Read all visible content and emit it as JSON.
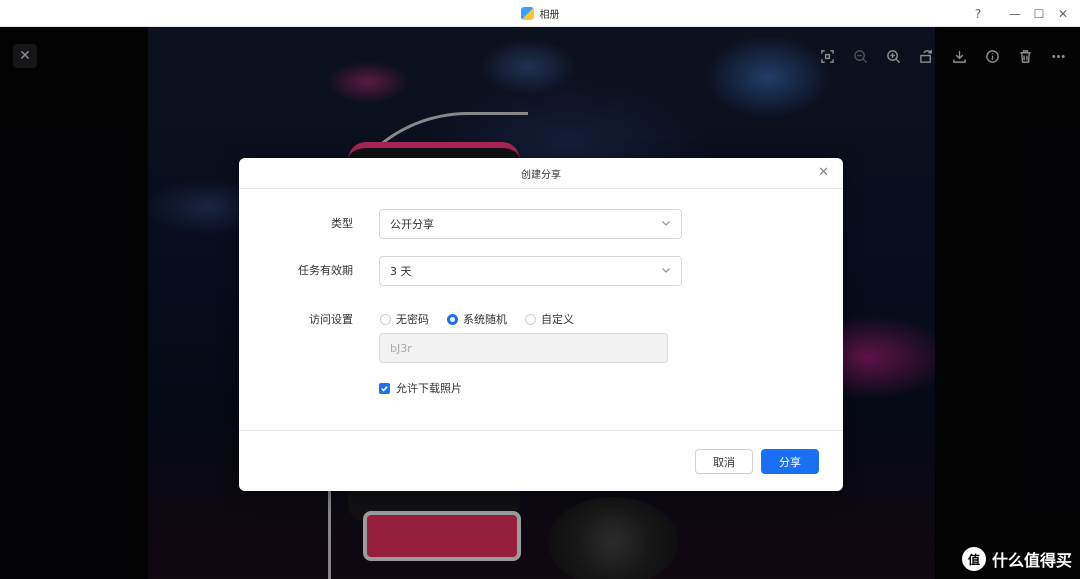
{
  "window": {
    "title": "相册",
    "controls": [
      "?",
      "—",
      "☐",
      "✕"
    ]
  },
  "viewer": {
    "toolbar_icons": [
      "scan-icon",
      "zoom-out-icon",
      "zoom-in-icon",
      "rotate-icon",
      "download-icon",
      "info-icon",
      "delete-icon",
      "more-icon"
    ]
  },
  "dialog": {
    "title": "创建分享",
    "type_label": "类型",
    "type_value": "公开分享",
    "expiry_label": "任务有效期",
    "expiry_value": "3 天",
    "access_label": "访问设置",
    "access_options": [
      {
        "label": "无密码",
        "selected": false
      },
      {
        "label": "系统随机",
        "selected": true
      },
      {
        "label": "自定义",
        "selected": false
      }
    ],
    "password_value": "bJ3r",
    "allow_download_label": "允许下载照片",
    "allow_download_checked": true,
    "cancel_label": "取消",
    "share_label": "分享"
  },
  "watermark": {
    "logo_text": "值",
    "text": "什么值得买"
  },
  "colors": {
    "accent": "#1a6ff5",
    "overlay": "rgba(0,0,0,0.35)"
  }
}
